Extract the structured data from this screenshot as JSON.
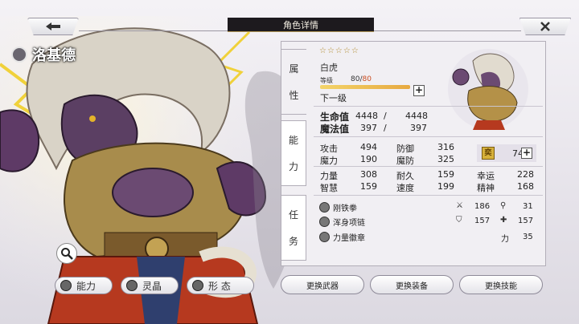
{
  "header": {
    "title": "角色详情",
    "back_icon": "back-arrow-icon",
    "close_icon": "close-x-icon"
  },
  "hero": {
    "name": "洛基德"
  },
  "left_tabs": [
    {
      "label": "能力",
      "icon": "ability-icon"
    },
    {
      "label": "灵晶",
      "icon": "crystal-icon"
    },
    {
      "label": "形 态",
      "icon": "form-icon"
    }
  ],
  "side_tabs": {
    "attribute": [
      "属",
      "性"
    ],
    "ability": [
      "能",
      "力"
    ],
    "task": [
      "任",
      "务"
    ]
  },
  "attributes": {
    "stars": "☆☆☆☆☆",
    "race": "白虎",
    "level_label": "等级",
    "level_current": "80",
    "level_sep": "/",
    "level_max": "80",
    "level_progress": 1.0,
    "next_level": "下一级"
  },
  "vitals": [
    {
      "label": "生命值",
      "current": "4448",
      "sep": "/",
      "max": "4448"
    },
    {
      "label": "魔法值",
      "current": "397",
      "sep": "/",
      "max": "397"
    }
  ],
  "stats": {
    "attack_label": "攻击",
    "attack": "494",
    "defense_label": "防御",
    "defense": "316",
    "magic_label": "魔力",
    "magic": "190",
    "mdef_label": "魔防",
    "mdef": "325",
    "power_label": "力量",
    "power": "308",
    "stamina_label": "耐久",
    "stamina": "159",
    "luck_label": "幸运",
    "luck": "228",
    "wisdom_label": "智慧",
    "wisdom": "159",
    "speed_label": "速度",
    "speed": "199",
    "spirit_label": "精神",
    "spirit": "168",
    "gold_value": "74",
    "gold_glyph": "奕"
  },
  "equipment": [
    {
      "name": "刚铁拳",
      "icon": "fist-icon"
    },
    {
      "name": "浑身项链",
      "icon": "necklace-icon"
    },
    {
      "name": "力量徽章",
      "icon": "badge-icon"
    }
  ],
  "equip_stats": {
    "sword_val": "186",
    "key_val": "31",
    "shield_val": "157",
    "cross_val": "157",
    "power_label": "力",
    "power_val": "35"
  },
  "actions": {
    "weapon": "更换武器",
    "gear": "更换装备",
    "skill": "更换技能"
  }
}
